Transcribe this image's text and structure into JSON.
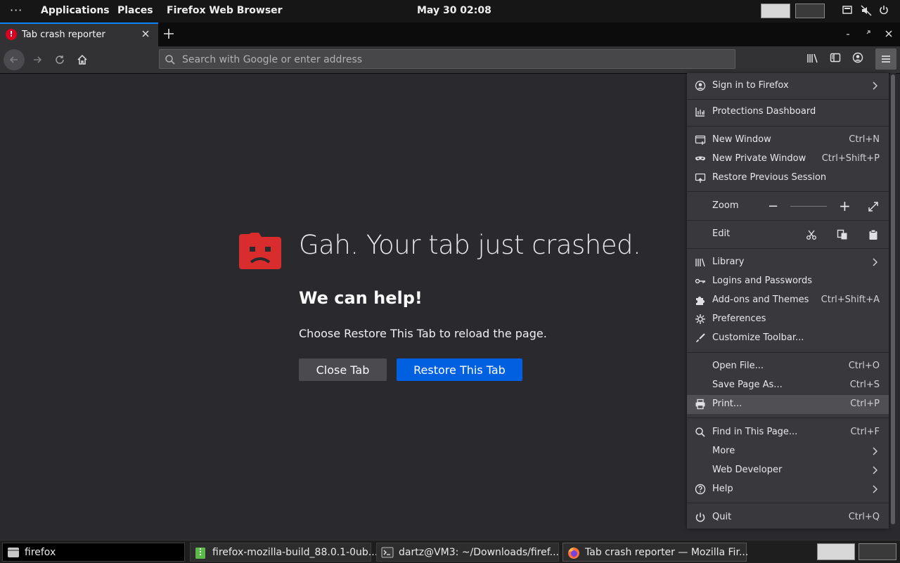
{
  "topbar": {
    "activities": "···",
    "menus": [
      "Applications",
      "Places",
      "Firefox Web Browser"
    ],
    "clock": "May 30  02:08"
  },
  "tabs": [
    {
      "title": "Tab crash reporter",
      "status_icon": "error-icon"
    }
  ],
  "navbar": {
    "search_placeholder": "Search with Google or enter address"
  },
  "crash": {
    "title": "Gah. Your tab just crashed.",
    "help": "We can help!",
    "instructions": "Choose Restore This Tab to reload the page.",
    "close_label": "Close Tab",
    "restore_label": "Restore This Tab"
  },
  "app_menu": {
    "sign_in": "Sign in to Firefox",
    "protections": "Protections Dashboard",
    "new_window": {
      "label": "New Window",
      "shortcut": "Ctrl+N"
    },
    "new_private": {
      "label": "New Private Window",
      "shortcut": "Ctrl+Shift+P"
    },
    "restore_session": "Restore Previous Session",
    "zoom": {
      "label": "Zoom",
      "minus": "−",
      "plus": "+"
    },
    "edit": {
      "label": "Edit"
    },
    "library": "Library",
    "logins": "Logins and Passwords",
    "addons": {
      "label": "Add-ons and Themes",
      "shortcut": "Ctrl+Shift+A"
    },
    "preferences": "Preferences",
    "customize": "Customize Toolbar...",
    "open_file": {
      "label": "Open File...",
      "shortcut": "Ctrl+O"
    },
    "save_page": {
      "label": "Save Page As...",
      "shortcut": "Ctrl+S"
    },
    "print": {
      "label": "Print...",
      "shortcut": "Ctrl+P"
    },
    "find": {
      "label": "Find in This Page...",
      "shortcut": "Ctrl+F"
    },
    "more": "More",
    "web_developer": "Web Developer",
    "help": "Help",
    "quit": {
      "label": "Quit",
      "shortcut": "Ctrl+Q"
    }
  },
  "taskbar": {
    "items": [
      {
        "label": "firefox"
      },
      {
        "label": "firefox-mozilla-build_88.0.1-0ub..."
      },
      {
        "label": "dartz@VM3: ~/Downloads/firef..."
      },
      {
        "label": "Tab crash reporter — Mozilla Fir..."
      }
    ]
  },
  "colors": {
    "page_bg": "#2a2a2e",
    "accent": "#0060df",
    "crash_red": "#d92d2d",
    "menu_bg": "#38383d"
  }
}
